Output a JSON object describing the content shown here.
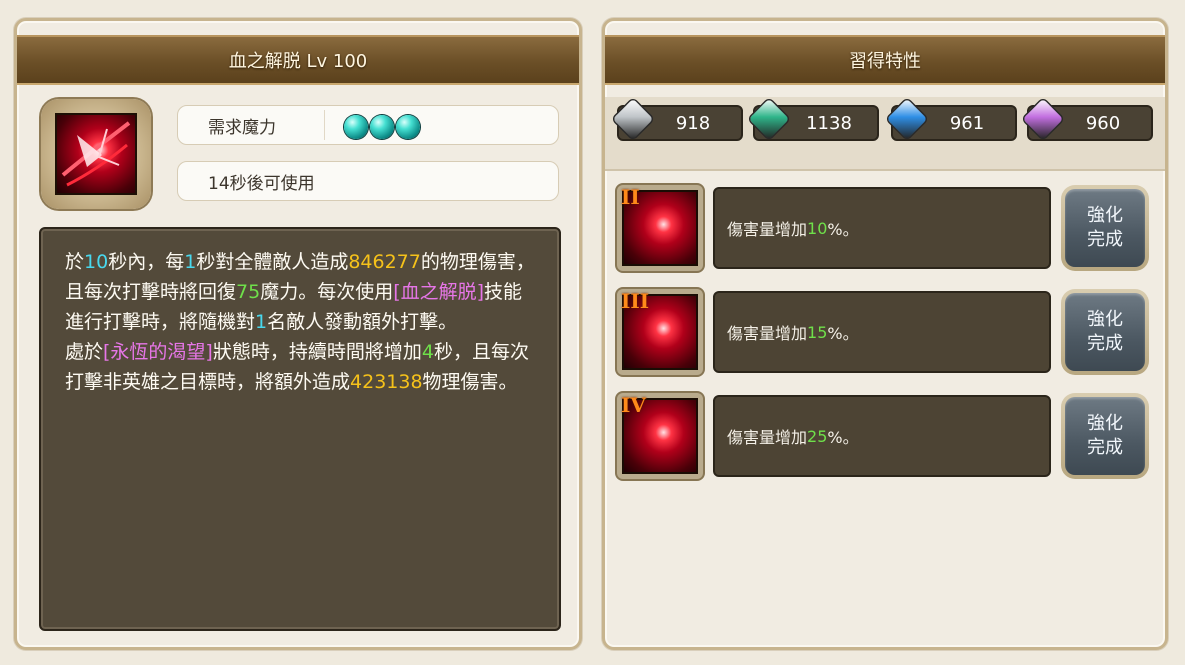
{
  "skill_panel": {
    "title": "血之解脱 Lv 100",
    "icon": "blood-slash-skill-icon",
    "mana_label": "需求魔力",
    "mana_cost": 3,
    "cooldown_text": "14秒後可使用",
    "description": [
      [
        [
          "於"
        ],
        [
          "10",
          "cyan"
        ],
        [
          "秒內，每"
        ],
        [
          "1",
          "cyan"
        ],
        [
          "秒對全體敵人造成"
        ],
        [
          "846277",
          "gold"
        ],
        [
          "的物理傷害，且每次打擊時將回復"
        ],
        [
          "75",
          "green"
        ],
        [
          "魔力。每次使用"
        ],
        [
          "[血之解脱]",
          "pink"
        ],
        [
          "技能進行打擊時，將隨機對"
        ],
        [
          "1",
          "cyan"
        ],
        [
          "名敵人發動額外打擊。"
        ]
      ],
      [
        [
          "處於"
        ],
        [
          "[永恆的渴望]",
          "pink"
        ],
        [
          "狀態時，持續時間將增加"
        ],
        [
          "4",
          "green"
        ],
        [
          "秒，且每次打擊非英雄之目標時，將額外造成"
        ],
        [
          "423138",
          "gold"
        ],
        [
          "物理傷害。"
        ]
      ]
    ]
  },
  "trait_panel": {
    "title": "習得特性",
    "resources": [
      {
        "icon": "silver-rune-book-icon",
        "value": "918",
        "color": "#bfc4c8"
      },
      {
        "icon": "green-rune-book-icon",
        "value": "1138",
        "color": "#2fb58a"
      },
      {
        "icon": "blue-rune-book-icon",
        "value": "961",
        "color": "#2f8fe6"
      },
      {
        "icon": "purple-rune-book-icon",
        "value": "960",
        "color": "#c26fe0"
      }
    ],
    "traits": [
      {
        "roman": "II",
        "prefix": "傷害量增加",
        "percent": "10",
        "suffix": "%。",
        "button_line1": "強化",
        "button_line2": "完成"
      },
      {
        "roman": "III",
        "prefix": "傷害量增加",
        "percent": "15",
        "suffix": "%。",
        "button_line1": "強化",
        "button_line2": "完成"
      },
      {
        "roman": "IV",
        "prefix": "傷害量增加",
        "percent": "25",
        "suffix": "%。",
        "button_line1": "強化",
        "button_line2": "完成"
      }
    ]
  }
}
